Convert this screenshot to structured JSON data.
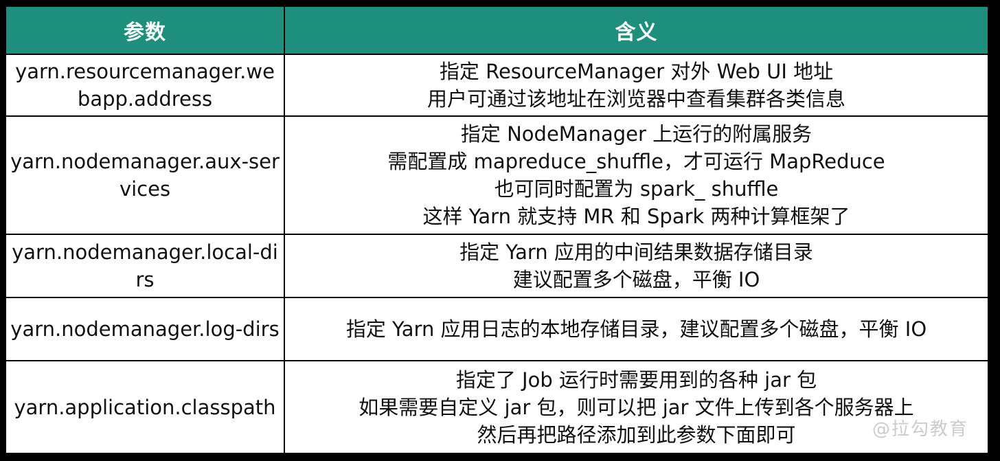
{
  "header": {
    "col_param": "参数",
    "col_meaning": "含义"
  },
  "rows": [
    {
      "param": "yarn.resourcemanager.webapp.address",
      "meaning": [
        "指定 ResourceManager 对外 Web UI 地址",
        "用户可通过该地址在浏览器中查看集群各类信息"
      ]
    },
    {
      "param": "yarn.nodemanager.aux-services",
      "meaning": [
        "指定 NodeManager 上运行的附属服务",
        "需配置成 mapreduce_shuffle，才可运行 MapReduce",
        "也可同时配置为 spark_ shuffle",
        "这样 Yarn 就支持 MR 和 Spark 两种计算框架了"
      ]
    },
    {
      "param": "yarn.nodemanager.local-dirs",
      "meaning": [
        "指定 Yarn 应用的中间结果数据存储目录",
        "建议配置多个磁盘，平衡 IO"
      ]
    },
    {
      "param": "yarn.nodemanager.log-dirs",
      "meaning": [
        "指定 Yarn 应用日志的本地存储目录，建议配置多个磁盘，平衡 IO"
      ]
    },
    {
      "param": "yarn.application.classpath",
      "meaning": [
        "指定了 Job 运行时需要用到的各种 jar 包",
        "如果需要自定义 jar 包，则可以把 jar 文件上传到各个服务器上",
        "然后再把路径添加到此参数下面即可"
      ]
    }
  ],
  "watermark": "@拉勾教育",
  "colors": {
    "header_bg": "#1f8f7d",
    "header_text": "#ffffff",
    "border": "#000000"
  }
}
